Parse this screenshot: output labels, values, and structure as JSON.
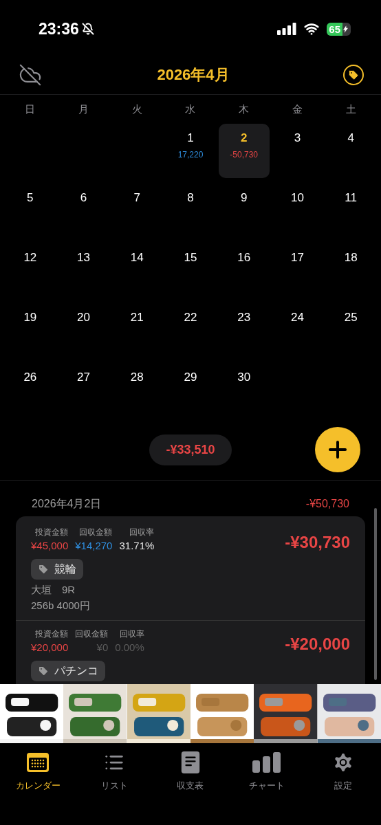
{
  "status_bar": {
    "time": "23:36",
    "battery": "65"
  },
  "header": {
    "title": "2026年4月"
  },
  "weekdays": [
    "日",
    "月",
    "火",
    "水",
    "木",
    "金",
    "土"
  ],
  "weeks": [
    [
      {
        "day": "1",
        "amount": "17,220",
        "kind": "gain",
        "selected": false
      },
      {
        "day": "2",
        "amount": "-50,730",
        "kind": "loss",
        "selected": true
      },
      {
        "day": "3",
        "selected": false
      },
      {
        "day": "4",
        "selected": false
      }
    ],
    [
      {
        "day": "5",
        "selected": false
      },
      {
        "day": "6",
        "selected": false
      },
      {
        "day": "7",
        "selected": false
      },
      {
        "day": "8",
        "selected": false
      },
      {
        "day": "9",
        "selected": false
      },
      {
        "day": "10",
        "selected": false
      },
      {
        "day": "11",
        "selected": false
      }
    ],
    [
      {
        "day": "12",
        "selected": false
      },
      {
        "day": "13",
        "selected": false
      },
      {
        "day": "14",
        "selected": false
      },
      {
        "day": "15",
        "selected": false
      },
      {
        "day": "16",
        "selected": false
      },
      {
        "day": "17",
        "selected": false
      },
      {
        "day": "18",
        "selected": false
      }
    ],
    [
      {
        "day": "19",
        "selected": false
      },
      {
        "day": "20",
        "selected": false
      },
      {
        "day": "21",
        "selected": false
      },
      {
        "day": "22",
        "selected": false
      },
      {
        "day": "23",
        "selected": false
      },
      {
        "day": "24",
        "selected": false
      },
      {
        "day": "25",
        "selected": false
      }
    ],
    [
      {
        "day": "26",
        "selected": false
      },
      {
        "day": "27",
        "selected": false
      },
      {
        "day": "28",
        "selected": false
      },
      {
        "day": "29",
        "selected": false
      },
      {
        "day": "30",
        "selected": false
      }
    ]
  ],
  "month_total": "-¥33,510",
  "day_detail": {
    "date": "2026年4月2日",
    "total": "-¥50,730",
    "entries": [
      {
        "stats": [
          {
            "label": "投資金額",
            "value": "¥45,000",
            "kind": "loss"
          },
          {
            "label": "回収金額",
            "value": "¥14,270",
            "kind": "gain"
          },
          {
            "label": "回収率",
            "value": "31.71%",
            "kind": "plain"
          }
        ],
        "result": "-¥30,730",
        "tag": "競輪",
        "notes": [
          "大垣　9R",
          "256b 4000円"
        ]
      },
      {
        "stats": [
          {
            "label": "投資金額",
            "value": "¥20,000",
            "kind": "loss"
          },
          {
            "label": "回収金額",
            "value": "¥0",
            "kind": "muted"
          },
          {
            "label": "回収率",
            "value": "0.00%",
            "kind": "muted"
          }
        ],
        "result": "-¥20,000",
        "tag": "パチンコ"
      }
    ]
  },
  "ad_banner": [
    {
      "kind": "picture"
    },
    {
      "kind": "picture"
    },
    {
      "kind": "picture"
    },
    {
      "kind": "picture"
    },
    {
      "kind": "picture"
    },
    {
      "kind": "picture"
    }
  ],
  "tab_bar": [
    {
      "label": "カレンダー",
      "selected": true
    },
    {
      "label": "リスト",
      "selected": false
    },
    {
      "label": "収支表",
      "selected": false
    },
    {
      "label": "チャート",
      "selected": false
    },
    {
      "label": "設定",
      "selected": false
    }
  ]
}
